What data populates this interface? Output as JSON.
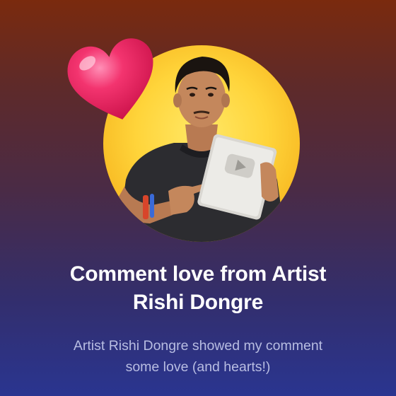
{
  "card": {
    "title_line1": "Comment love from Artist",
    "title_line2": "Rishi Dongre",
    "subtitle_line1": "Artist Rishi Dongre showed my comment",
    "subtitle_line2": "some love (and hearts!)"
  },
  "avatar": {
    "icon": "person-with-play-button-award",
    "background_color": "#ffd43a"
  },
  "decoration": {
    "icon": "heart-icon",
    "color": "#f0286e"
  },
  "colors": {
    "gradient_top": "#7a2a0e",
    "gradient_bottom": "#2a3590",
    "title": "#ffffff",
    "subtitle": "#b8bde2"
  }
}
